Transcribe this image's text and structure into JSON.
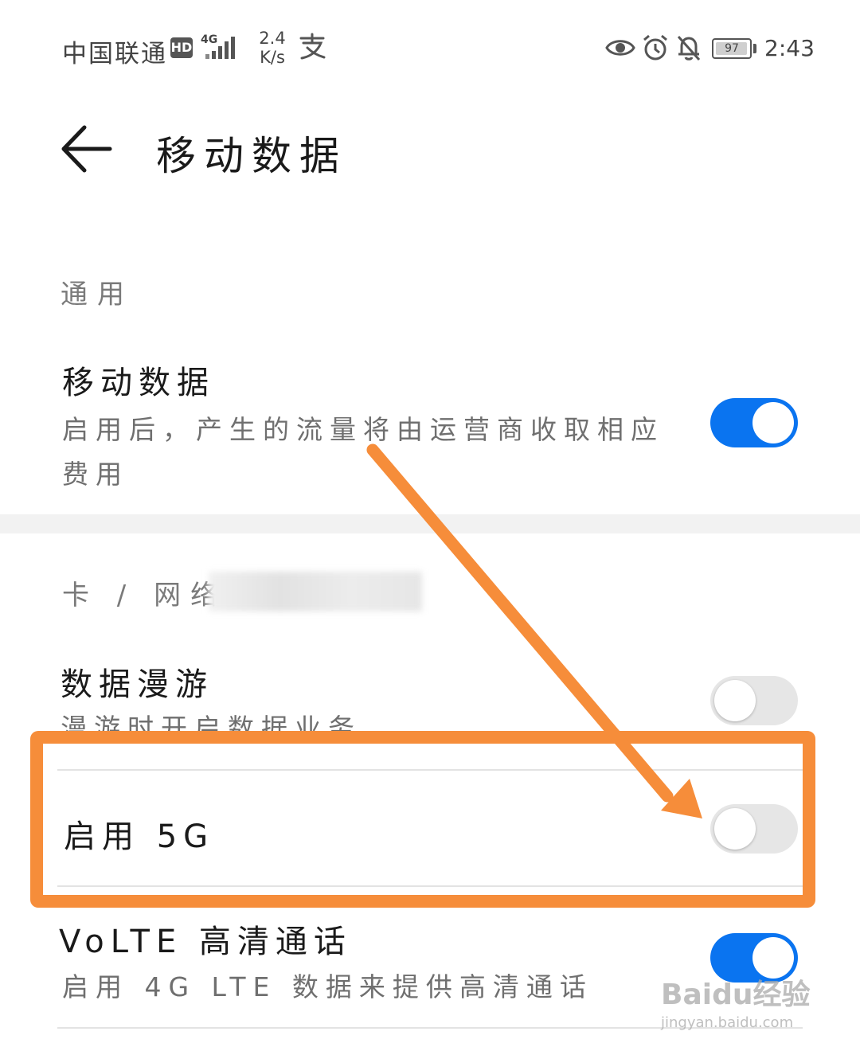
{
  "status_bar": {
    "carrier": "中国联通",
    "hd_badge": "HD",
    "network_type": "4G",
    "speed_value": "2.4",
    "speed_unit": "K/s",
    "battery_level": "97",
    "time": "2:43",
    "icons": [
      "signal-icon",
      "alipay-icon",
      "eye-icon",
      "alarm-icon",
      "bell-off-icon",
      "battery-icon"
    ]
  },
  "header": {
    "title": "移动数据"
  },
  "sections": {
    "general_label": "通用",
    "card_network_label": "卡 / 网络"
  },
  "settings": {
    "mobile_data": {
      "title": "移动数据",
      "subtitle": "启用后，产生的流量将由运营商收取相应费用",
      "enabled": true
    },
    "data_roaming": {
      "title": "数据漫游",
      "subtitle": "漫游时开启数据业务",
      "enabled": false
    },
    "enable_5g": {
      "title": "启用 5G",
      "enabled": false
    },
    "volte": {
      "title": "VoLTE 高清通话",
      "subtitle": "启用 4G LTE 数据来提供高清通话",
      "enabled": true
    }
  },
  "annotation": {
    "color": "#f68d3a"
  },
  "watermark": {
    "logo": "Baidu经验",
    "url": "jingyan.baidu.com"
  },
  "colors": {
    "toggle_on": "#0a74f0",
    "toggle_off": "#e6e6e6"
  }
}
